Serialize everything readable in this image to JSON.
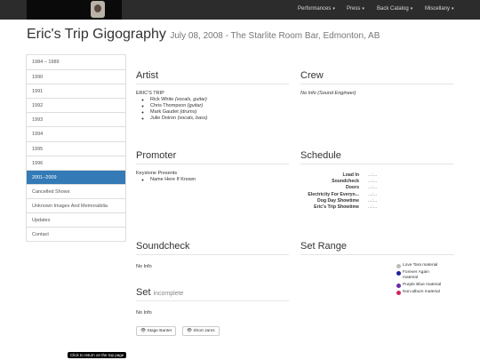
{
  "nav": {
    "items": [
      "Performances",
      "Press",
      "Back Catalog",
      "Miscellany"
    ]
  },
  "title": {
    "main": "Eric's Trip Gigography",
    "subtitle": "July 08, 2008 - The Starlite Room Bar, Edmonton, AB"
  },
  "sidebar": {
    "items": [
      "1984 – 1989",
      "1990",
      "1991",
      "1992",
      "1993",
      "1994",
      "1995",
      "1996",
      "2001–2009",
      "Cancelled Shows",
      "Unknown Images And Memorabilia",
      "Updates",
      "Contact"
    ],
    "active": "2001–2009"
  },
  "artist": {
    "heading": "Artist",
    "name": "ERIC'S TRIP",
    "members": [
      {
        "name": "Rick White",
        "role": "(vocals, guitar)"
      },
      {
        "name": "Chris Thompson",
        "role": "(guitar)"
      },
      {
        "name": "Mark Gaudet",
        "role": "(drums)"
      },
      {
        "name": "Julie Doiron",
        "role": "(vocals, bass)"
      }
    ]
  },
  "crew": {
    "heading": "Crew",
    "info": "No Info",
    "role": "(Sound Engineer)"
  },
  "promoter": {
    "heading": "Promoter",
    "name": "Keystone Presents",
    "member": "Name Here If Known"
  },
  "schedule": {
    "heading": "Schedule",
    "rows": [
      {
        "label": "Load In",
        "value": "...:..."
      },
      {
        "label": "Soundcheck",
        "value": "...:..."
      },
      {
        "label": "Doors",
        "value": "...:..."
      },
      {
        "label": "Electricity For Everyo...",
        "value": "...:..."
      },
      {
        "label": "Dog Day Showtime",
        "value": "...:..."
      },
      {
        "label": "Eric's Trip Showtime",
        "value": "...:..."
      }
    ]
  },
  "soundcheck": {
    "heading": "Soundcheck",
    "info": "No Info"
  },
  "setrange": {
    "heading": "Set Range",
    "legend": [
      {
        "label": "Love Tara material",
        "color": "#bbbbbb"
      },
      {
        "label": "Forever Again material",
        "color": "#2020a0"
      },
      {
        "label": "Purple Blue material",
        "color": "#6b2aa8"
      },
      {
        "label": "Non-album material",
        "color": "#d0245a"
      }
    ]
  },
  "set": {
    "heading": "Set",
    "status": "incomplete",
    "info": "No Info",
    "buttons": [
      "Stage Banter",
      "Short Jams"
    ]
  },
  "tooltip": "Click to return on the top page"
}
